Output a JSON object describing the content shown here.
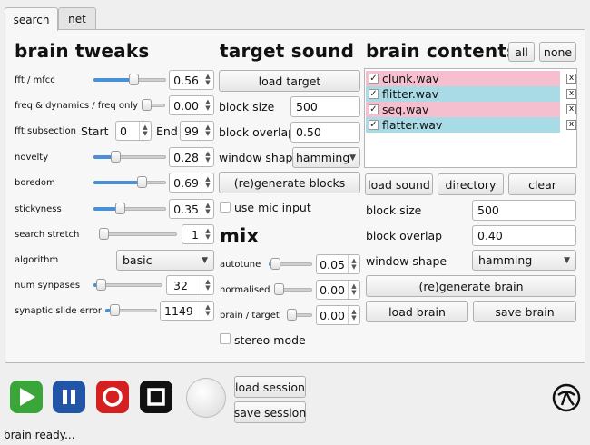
{
  "tabs": [
    {
      "label": "search",
      "active": true
    },
    {
      "label": "net",
      "active": false
    }
  ],
  "brain_tweaks": {
    "title": "brain tweaks",
    "fft": {
      "label": "fft / mfcc",
      "value": "0.56",
      "level": 0.56
    },
    "freq": {
      "label": "freq & dynamics / freq only",
      "value": "0.00",
      "level": 0.0
    },
    "subsection": {
      "label": "fft subsection",
      "start_label": "Start",
      "start": "0",
      "end_label": "End",
      "end": "99"
    },
    "novelty": {
      "label": "novelty",
      "value": "0.28",
      "level": 0.28
    },
    "boredom": {
      "label": "boredom",
      "value": "0.69",
      "level": 0.69
    },
    "stickyness": {
      "label": "stickyness",
      "value": "0.35",
      "level": 0.35
    },
    "search_stretch": {
      "label": "search stretch",
      "value": "1",
      "level": 0.0
    },
    "algorithm": {
      "label": "algorithm",
      "value": "basic"
    },
    "num_synapses": {
      "label": "num synpases",
      "value": "32",
      "level": 0.04
    },
    "slide_error": {
      "label": "synaptic slide error",
      "value": "1149",
      "level": 0.1
    }
  },
  "target_sound": {
    "title": "target sound",
    "load_label": "load target",
    "block_size": {
      "label": "block size",
      "value": "500"
    },
    "block_overlap": {
      "label": "block overlap",
      "value": "0.50"
    },
    "window_shape": {
      "label": "window shape",
      "value": "hamming"
    },
    "regen_label": "(re)generate blocks",
    "mic_label": "use mic input",
    "mic_checked": false
  },
  "mix": {
    "title": "mix",
    "autotune": {
      "label": "autotune",
      "value": "0.05",
      "level": 0.05
    },
    "normalised": {
      "label": "normalised",
      "value": "0.00",
      "level": 0.0
    },
    "brain_target": {
      "label": "brain / target",
      "value": "0.00",
      "level": 0.0
    },
    "stereo_label": "stereo mode",
    "stereo_checked": false
  },
  "brain_contents": {
    "title": "brain contents",
    "all_label": "all",
    "none_label": "none",
    "items": [
      {
        "name": "clunk.wav",
        "checked": true,
        "color": "#f5bfd0"
      },
      {
        "name": "flitter.wav",
        "checked": true,
        "color": "#a9dbe6"
      },
      {
        "name": "seq.wav",
        "checked": true,
        "color": "#f5bfd0"
      },
      {
        "name": "flatter.wav",
        "checked": true,
        "color": "#a9dbe6"
      }
    ],
    "check_mark": "✓",
    "remove_mark": "x",
    "load_sound_label": "load sound",
    "directory_label": "directory",
    "clear_label": "clear",
    "block_size": {
      "label": "block size",
      "value": "500"
    },
    "block_overlap": {
      "label": "block overlap",
      "value": "0.40"
    },
    "window_shape": {
      "label": "window shape",
      "value": "hamming"
    },
    "regen_label": "(re)generate brain",
    "load_brain_label": "load brain",
    "save_brain_label": "save brain"
  },
  "transport": {
    "play_color": "#3aa63a",
    "pause_color": "#2255a8",
    "record_color": "#d42020",
    "stop_color": "#111111"
  },
  "session": {
    "load_label": "load session",
    "save_label": "save session"
  },
  "status": "brain ready..."
}
